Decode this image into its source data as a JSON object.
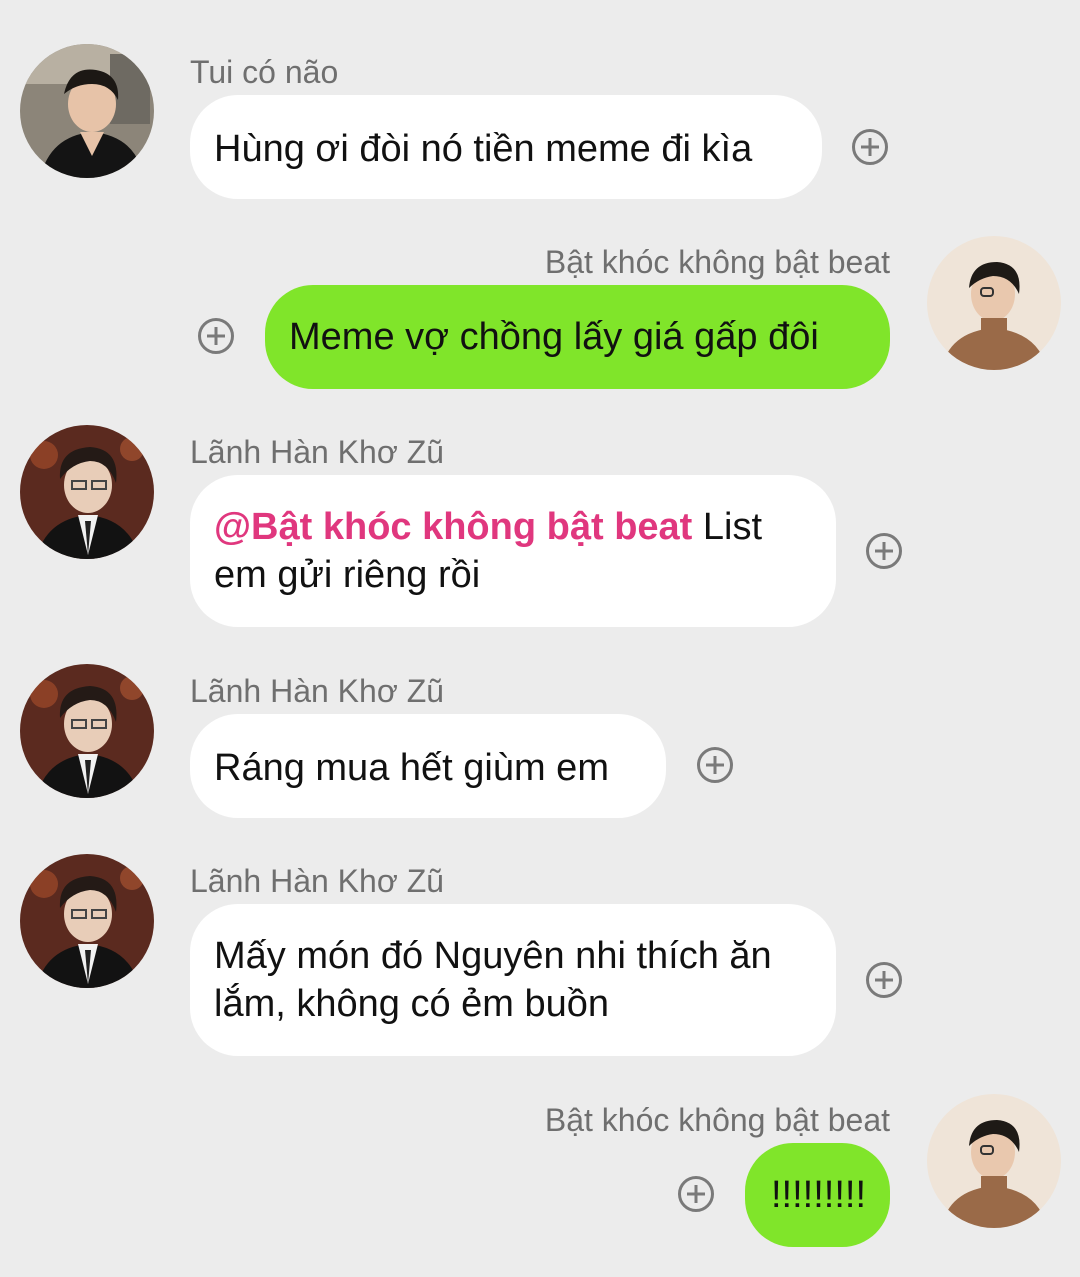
{
  "messages": [
    {
      "sender": "Tui có não",
      "direction": "incoming",
      "avatar": "avatar-man-black-jacket",
      "text": "Hùng ơi đòi nó tiền meme đi kìa"
    },
    {
      "sender": "Bật khóc không bật beat",
      "direction": "outgoing",
      "avatar": "avatar-man-brown-sweater",
      "text": "Meme vợ chồng lấy giá gấp đôi"
    },
    {
      "sender": "Lãnh Hàn Khơ Zũ",
      "direction": "incoming",
      "avatar": "avatar-man-suit",
      "mention": "@Bật khóc không bật beat",
      "text_after_mention": " List em gửi riêng rồi"
    },
    {
      "sender": "Lãnh Hàn Khơ Zũ",
      "direction": "incoming",
      "avatar": "avatar-man-suit",
      "text": "Ráng mua hết giùm em"
    },
    {
      "sender": "Lãnh Hàn Khơ Zũ",
      "direction": "incoming",
      "avatar": "avatar-man-suit",
      "text": "Mấy món đó Nguyên nhi thích ăn lắm, không có ẻm buồn"
    },
    {
      "sender": "Bật khóc không bật beat",
      "direction": "outgoing",
      "avatar": "avatar-man-brown-sweater",
      "text": "!!!!!!!!!"
    }
  ],
  "colors": {
    "background": "#ececec",
    "incoming_bubble": "#ffffff",
    "outgoing_bubble": "#80e52a",
    "mention": "#e0377e",
    "sender_name": "#6f6f6f"
  },
  "icons": {
    "reaction": "plus-circle-icon"
  }
}
